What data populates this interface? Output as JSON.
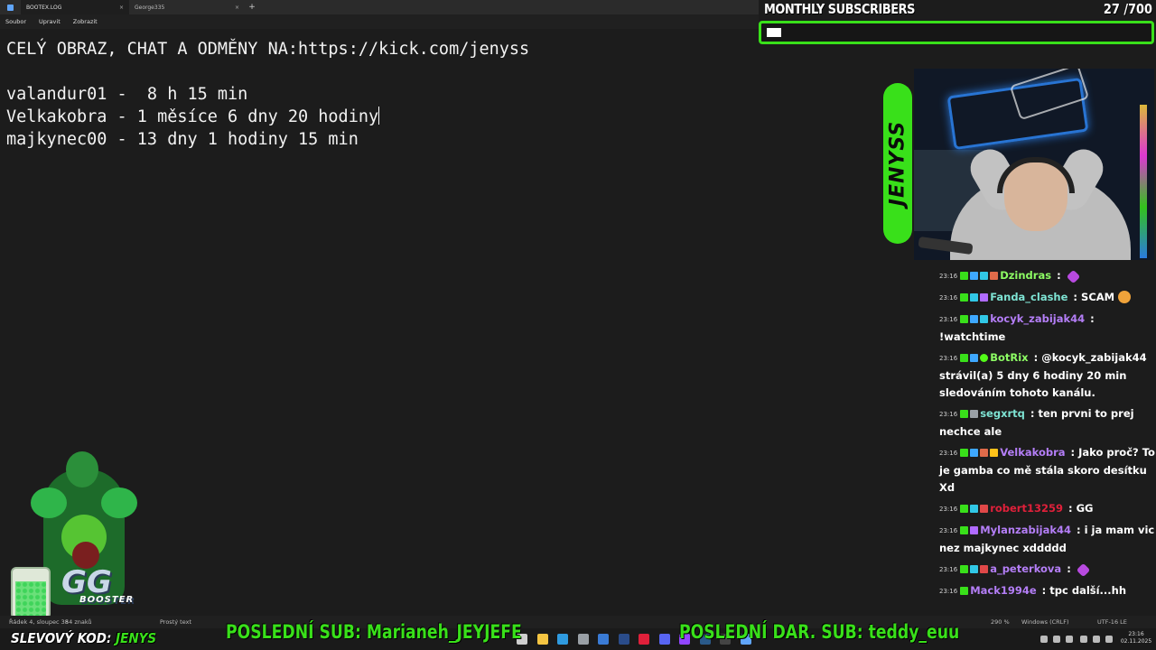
{
  "tabs": [
    {
      "label": "BOOTEX.LOG",
      "close": "×"
    },
    {
      "label": "George335",
      "close": "×"
    }
  ],
  "tab_add": "+",
  "menu": [
    "Soubor",
    "Upravit",
    "Zobrazit"
  ],
  "editor": {
    "lines": [
      "CELÝ OBRAZ, CHAT A ODMĚNY NA:https://kick.com/jenyss",
      "",
      "valandur01 -  8 h 15 min",
      "Velkakobra - 1 měsíce 6 dny 20 hodiny",
      "majkynec00 - 13 dny 1 hodiny 15 min"
    ]
  },
  "subscribers": {
    "title": "MONTHLY SUBSCRIBERS",
    "current": 27,
    "goal": 700,
    "separator": "/",
    "progress": 0.0386
  },
  "brand": "JENYSS",
  "chat": [
    {
      "time": "23:16",
      "badges": [
        "k",
        "s",
        "c",
        "p"
      ],
      "user": "Dzindras",
      "color": "#8dfc64",
      "text": "",
      "emote": "heart"
    },
    {
      "time": "23:16",
      "badges": [
        "k",
        "c",
        "e"
      ],
      "user": "Fanda_clashe",
      "color": "#7ee3d3",
      "text": "SCAM",
      "emote": "laugh"
    },
    {
      "time": "23:16",
      "badges": [
        "k",
        "s",
        "c"
      ],
      "user": "kocyk_zabijak44",
      "color": "#b47ef7",
      "text": "!watchtime",
      "emote": ""
    },
    {
      "time": "23:16",
      "badges": [
        "k",
        "s",
        "v"
      ],
      "user": "BotRix",
      "color": "#8dfc64",
      "text": "@kocyk_zabijak44 strávil(a) 5 dny 6 hodiny 20 min sledováním tohoto kanálu.",
      "emote": ""
    },
    {
      "time": "23:16",
      "badges": [
        "k",
        "m"
      ],
      "user": "segxrtq",
      "color": "#7ee3d3",
      "text": "ten prvni to prej nechce ale",
      "emote": ""
    },
    {
      "time": "23:16",
      "badges": [
        "k",
        "s",
        "p",
        "g"
      ],
      "user": "Velkakobra",
      "color": "#b47ef7",
      "text": "Jako proč? To je gamba co mě stála skoro desítku Xd",
      "emote": ""
    },
    {
      "time": "23:16",
      "badges": [
        "k",
        "c",
        "r"
      ],
      "user": "robert13259",
      "color": "#e0203a",
      "text": "GG",
      "emote": ""
    },
    {
      "time": "23:16",
      "badges": [
        "k",
        "e"
      ],
      "user": "Mylanzabijak44",
      "color": "#b47ef7",
      "text": "i ja mam vic nez majkynec xddddd",
      "emote": ""
    },
    {
      "time": "23:16",
      "badges": [
        "k",
        "c",
        "r"
      ],
      "user": "a_peterkova",
      "color": "#b47ef7",
      "text": "",
      "emote": "heart"
    },
    {
      "time": "23:16",
      "badges": [
        "k"
      ],
      "user": "Mack1994e",
      "color": "#b47ef7",
      "text": "tpc další...hh",
      "emote": ""
    }
  ],
  "booster": {
    "logo": "GG",
    "sub": "BOOSTER"
  },
  "statusbar": {
    "position": "Řádek 4, sloupec 38",
    "chars": "54 znaků",
    "type": "Prostý text",
    "zoom": "290 %",
    "eol": "Windows (CRLF)",
    "encoding": "UTF-16 LE"
  },
  "overlay": {
    "discount_label": "SLEVOVÝ KOD:",
    "discount_code": "JENYS",
    "last_sub": "POSLEDNÍ SUB: Marianeh_JEYJEFE",
    "last_gift_sub": "POSLEDNÍ DAR. SUB: teddy_euu"
  },
  "clock": {
    "time": "23:16",
    "date": "02.11.2025"
  },
  "taskbar_icons": [
    {
      "name": "task-view-icon",
      "color": "#cfcfcf"
    },
    {
      "name": "explorer-icon",
      "color": "#f5c542"
    },
    {
      "name": "edge-icon",
      "color": "#2f9be0"
    },
    {
      "name": "settings-icon",
      "color": "#9aa0a6"
    },
    {
      "name": "mail-icon",
      "color": "#3a7bd5"
    },
    {
      "name": "media-icon",
      "color": "#2a4c8a"
    },
    {
      "name": "opera-icon",
      "color": "#e0203a"
    },
    {
      "name": "discord-icon",
      "color": "#5865f2"
    },
    {
      "name": "twitch-icon",
      "color": "#9146ff"
    },
    {
      "name": "steam-icon",
      "color": "#2a5a8a"
    },
    {
      "name": "obs-icon",
      "color": "#444"
    },
    {
      "name": "notepad-icon",
      "color": "#60a5fa"
    }
  ]
}
